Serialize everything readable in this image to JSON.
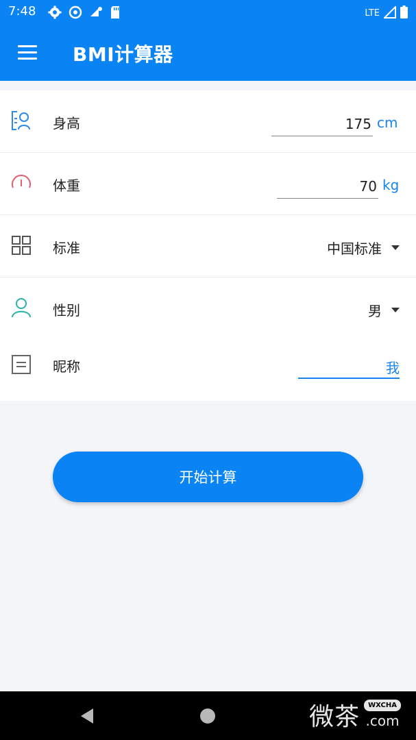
{
  "status_bar": {
    "time": "7:48",
    "network": "LTE",
    "icons": [
      "settings-icon",
      "sync-icon",
      "wifi-settings-icon",
      "sd-card-icon",
      "signal-icon",
      "battery-icon"
    ]
  },
  "app_bar": {
    "title": "BMI计算器",
    "menu_icon": "menu-icon",
    "color": "#0a84f5"
  },
  "form": {
    "height": {
      "label": "身高",
      "value": "175",
      "unit": "cm",
      "icon": "person-card-icon"
    },
    "weight": {
      "label": "体重",
      "value": "70",
      "unit": "kg",
      "icon": "gauge-icon"
    },
    "standard": {
      "label": "标准",
      "selected": "中国标准",
      "icon": "grid-icon"
    },
    "gender": {
      "label": "性别",
      "selected": "男",
      "icon": "user-icon"
    },
    "nickname": {
      "label": "昵称",
      "value": "我",
      "icon": "note-icon"
    }
  },
  "actions": {
    "calculate_label": "开始计算"
  },
  "nav_bar": {
    "buttons": [
      "back-icon",
      "home-icon"
    ]
  },
  "watermark": {
    "text": "微茶",
    "badge": "WXCHA",
    "domain": ".com"
  },
  "colors": {
    "primary": "#0a84f5",
    "accent_text": "#1784ef",
    "background": "#f3f5f9"
  }
}
